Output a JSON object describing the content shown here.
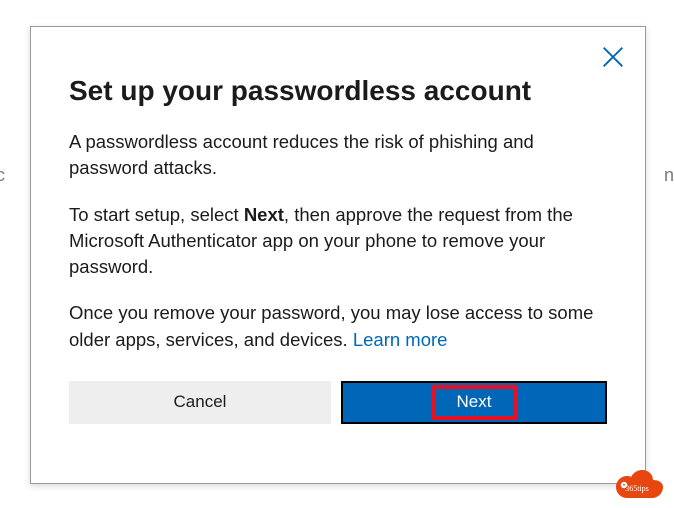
{
  "dialog": {
    "title": "Set up your passwordless account",
    "para1": "A passwordless account reduces the risk of phishing and password attacks.",
    "para2_a": "To start setup, select ",
    "para2_bold": "Next",
    "para2_b": ", then approve the request from the Microsoft Authenticator app on your phone to remove your password.",
    "para3_a": "Once you remove your password, you may lose access to some older apps, services, and devices. ",
    "learn_more": "Learn more",
    "cancel_label": "Cancel",
    "next_label": "Next"
  },
  "backdrop": {
    "left_fragment": "rec",
    "right_fragment": "np"
  },
  "badge": {
    "text": "365tips"
  }
}
